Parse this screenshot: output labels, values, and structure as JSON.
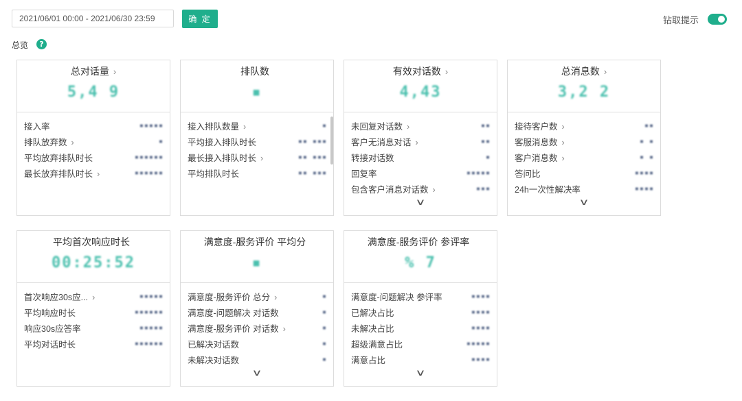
{
  "toolbar": {
    "date_range": "2021/06/01 00:00 - 2021/06/30 23:59",
    "confirm_label": "确 定",
    "drill_label": "钻取提示"
  },
  "overview": {
    "label": "总览",
    "help_icon": "?"
  },
  "cards": [
    {
      "title": "总对话量",
      "title_arrow": "›",
      "value": "5,4 9",
      "rows": [
        {
          "label": "接入率",
          "arrow": "",
          "value": "▪▪▪▪▪"
        },
        {
          "label": "排队放弃数",
          "arrow": "›",
          "value": "▪"
        },
        {
          "label": "平均放弃排队时长",
          "arrow": "",
          "value": "▪▪▪▪▪▪"
        },
        {
          "label": "最长放弃排队时长",
          "arrow": "›",
          "value": "▪▪▪▪▪▪"
        }
      ]
    },
    {
      "title": "排队数",
      "title_arrow": "",
      "value": "▪",
      "rows": [
        {
          "label": "接入排队数量",
          "arrow": "›",
          "value": "▪"
        },
        {
          "label": "平均接入排队时长",
          "arrow": "",
          "value": "▪▪ ▪▪▪"
        },
        {
          "label": "最长接入排队时长",
          "arrow": "›",
          "value": "▪▪ ▪▪▪"
        },
        {
          "label": "平均排队时长",
          "arrow": "",
          "value": "▪▪ ▪▪▪"
        }
      ]
    },
    {
      "title": "有效对话数",
      "title_arrow": "›",
      "value": "4,43",
      "rows": [
        {
          "label": "未回复对话数",
          "arrow": "›",
          "value": "▪▪"
        },
        {
          "label": "客户无消息对话",
          "arrow": "›",
          "value": "▪▪"
        },
        {
          "label": "转接对话数",
          "arrow": "",
          "value": "▪"
        },
        {
          "label": "回复率",
          "arrow": "",
          "value": "▪▪▪▪▪"
        },
        {
          "label": "包含客户消息对话数",
          "arrow": "›",
          "value": "▪▪▪"
        }
      ],
      "expand_icon": "∨"
    },
    {
      "title": "总消息数",
      "title_arrow": "›",
      "value": "3,2 2",
      "rows": [
        {
          "label": "接待客户数",
          "arrow": "›",
          "value": "▪▪"
        },
        {
          "label": "客服消息数",
          "arrow": "›",
          "value": "▪ ▪"
        },
        {
          "label": "客户消息数",
          "arrow": "›",
          "value": "▪ ▪"
        },
        {
          "label": "答问比",
          "arrow": "",
          "value": "▪▪▪▪"
        },
        {
          "label": "24h一次性解决率",
          "arrow": "",
          "value": "▪▪▪▪"
        }
      ],
      "expand_icon": "∨"
    },
    {
      "title": "平均首次响应时长",
      "title_arrow": "",
      "value": "00:25:52",
      "rows": [
        {
          "label": "首次响应30s应...",
          "arrow": "›",
          "value": "▪▪▪▪▪"
        },
        {
          "label": "平均响应时长",
          "arrow": "",
          "value": "▪▪▪▪▪▪"
        },
        {
          "label": "响应30s应答率",
          "arrow": "",
          "value": "▪▪▪▪▪"
        },
        {
          "label": "平均对话时长",
          "arrow": "",
          "value": "▪▪▪▪▪▪"
        }
      ]
    },
    {
      "title": "满意度-服务评价 平均分",
      "title_arrow": "",
      "value": "▪",
      "rows": [
        {
          "label": "满意度-服务评价 总分",
          "arrow": "›",
          "value": "▪"
        },
        {
          "label": "满意度-问题解决 对话数",
          "arrow": "",
          "value": "▪"
        },
        {
          "label": "满意度-服务评价 对话数",
          "arrow": "›",
          "value": "▪"
        },
        {
          "label": "已解决对话数",
          "arrow": "",
          "value": "▪"
        },
        {
          "label": "未解决对话数",
          "arrow": "",
          "value": "▪"
        }
      ],
      "expand_icon": "∨"
    },
    {
      "title": "满意度-服务评价 参评率",
      "title_arrow": "",
      "value": "% 7",
      "rows": [
        {
          "label": "满意度-问题解决 参评率",
          "arrow": "",
          "value": "▪▪▪▪"
        },
        {
          "label": "已解决占比",
          "arrow": "",
          "value": "▪▪▪▪"
        },
        {
          "label": "未解决占比",
          "arrow": "",
          "value": "▪▪▪▪"
        },
        {
          "label": "超级满意占比",
          "arrow": "",
          "value": "▪▪▪▪▪"
        },
        {
          "label": "满意占比",
          "arrow": "",
          "value": "▪▪▪▪"
        }
      ],
      "expand_icon": "∨"
    }
  ],
  "colors": {
    "accent": "#1fae8c",
    "value_color": "#2bb5a0",
    "border": "#dcdcdc"
  }
}
